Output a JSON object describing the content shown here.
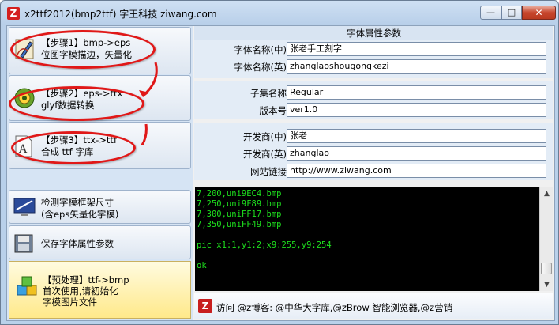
{
  "window": {
    "title": "x2ttf2012(bmp2ttf) 字王科技 ziwang.com",
    "app_icon": "Z",
    "min_glyph": "—",
    "max_glyph": "□",
    "close_glyph": "✕"
  },
  "steps": [
    {
      "line1": "【步骤1】bmp->eps",
      "line2": "位图字模描边，矢量化",
      "icon": "pen-tool-icon"
    },
    {
      "line1": "【步骤2】eps->ttx",
      "line2": "glyf数据转换",
      "icon": "gears-icon"
    },
    {
      "line1": "【步骤3】ttx->ttf",
      "line2": "合成 ttf 字库",
      "icon": "font-file-icon"
    }
  ],
  "tools": [
    {
      "line1": "检测字模框架尺寸",
      "line2": "(含eps矢量化字模)",
      "icon": "monitor-icon"
    },
    {
      "line1": "保存字体属性参数",
      "line2": "",
      "icon": "floppy-disk-icon"
    }
  ],
  "preprocess": {
    "line1": "【预处理】ttf->bmp",
    "line2": "首次使用,请初始化",
    "line3": "字模图片文件",
    "icon": "blocks-icon"
  },
  "properties": {
    "header": "字体属性参数",
    "fields": [
      {
        "label": "字体名称(中)",
        "value": "张老手工刻字"
      },
      {
        "label": "字体名称(英)",
        "value": "zhanglaoshougongkezi"
      },
      {
        "label": "子集名称",
        "value": "Regular"
      },
      {
        "label": "版本号",
        "value": "ver1.0"
      },
      {
        "label": "开发商(中)",
        "value": "张老"
      },
      {
        "label": "开发商(英)",
        "value": "zhanglao"
      },
      {
        "label": "网站链接",
        "value": "http://www.ziwang.com"
      }
    ]
  },
  "console_lines": [
    "7,200,uni9EC4.bmp",
    "7,250,uni9F89.bmp",
    "7,300,uniFF17.bmp",
    "7,350,uniFF49.bmp",
    "",
    "pic x1:1,y1:2;x9:255,y9:254",
    "",
    "ok"
  ],
  "footer": {
    "logo": "Z",
    "text": "访问 @z博客: @中华大字库,@zBrow 智能浏览器,@z营销"
  },
  "colors": {
    "annotation": "#e01818",
    "console_text": "#1ee01e",
    "console_bg": "#000000"
  }
}
